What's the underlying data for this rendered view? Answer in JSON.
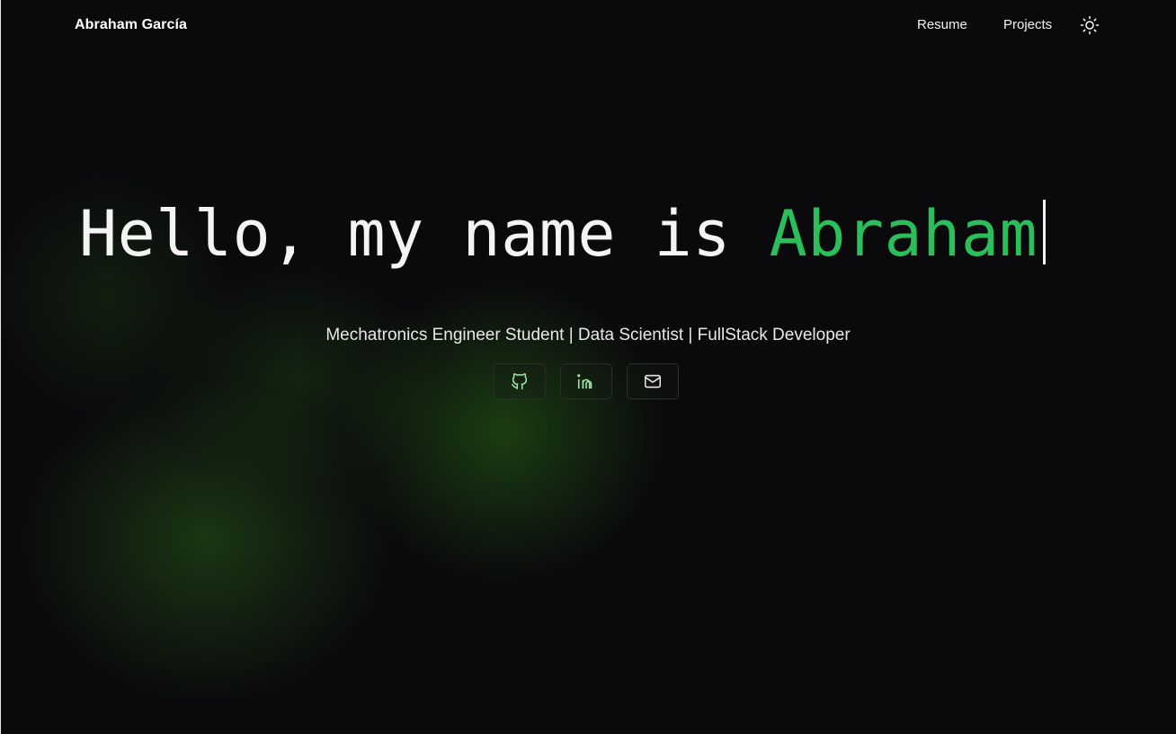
{
  "header": {
    "brand": "Abraham García",
    "nav": [
      {
        "label": "Resume"
      },
      {
        "label": "Projects"
      }
    ],
    "theme_toggle_icon": "sun-icon"
  },
  "hero": {
    "greeting": "Hello, my name is",
    "name": "Abraham",
    "subtitle": "Mechatronics Engineer Student | Data Scientist | FullStack Developer"
  },
  "socials": [
    {
      "icon": "github-icon"
    },
    {
      "icon": "linkedin-icon"
    },
    {
      "icon": "mail-icon"
    }
  ],
  "colors": {
    "background": "#0a0a0c",
    "accent": "#2bbf5c",
    "glow": "#265f16"
  }
}
